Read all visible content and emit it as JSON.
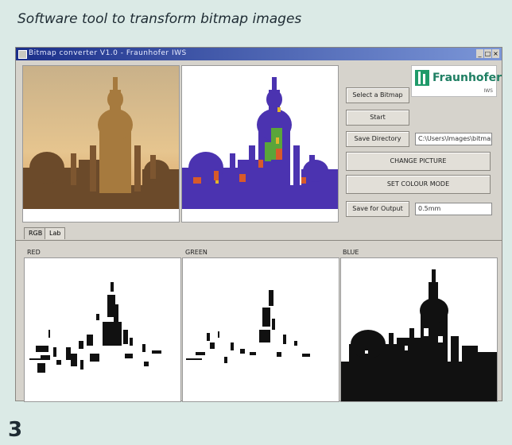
{
  "caption": "Software tool to transform bitmap images",
  "figure_number": "3",
  "window": {
    "title": "Bitmap converter V1.0 - Fraunhofer IWS",
    "controls": [
      "_",
      "□",
      "×"
    ]
  },
  "buttons": {
    "select_picture": "Select a Bitmap",
    "start": "Start",
    "save_directory": "Save Directory",
    "change_picture": "CHANGE PICTURE",
    "set_colour_mode": "SET COLOUR MODE",
    "save_for_output": "Save for Output"
  },
  "fields": {
    "directory_path": "C:\\Users\\Images\\bitmap",
    "output_value": "0.5mm"
  },
  "logo": {
    "name": "Fraunhofer",
    "sub": "IWS"
  },
  "tabs": [
    "RGB",
    "Lab"
  ],
  "channels": [
    "RED",
    "GREEN",
    "BLUE"
  ],
  "colors": {
    "window_bg": "#d6d3cc",
    "title_gradient_start": "#1b2f8a",
    "accent_logo": "#1f9a6a"
  }
}
